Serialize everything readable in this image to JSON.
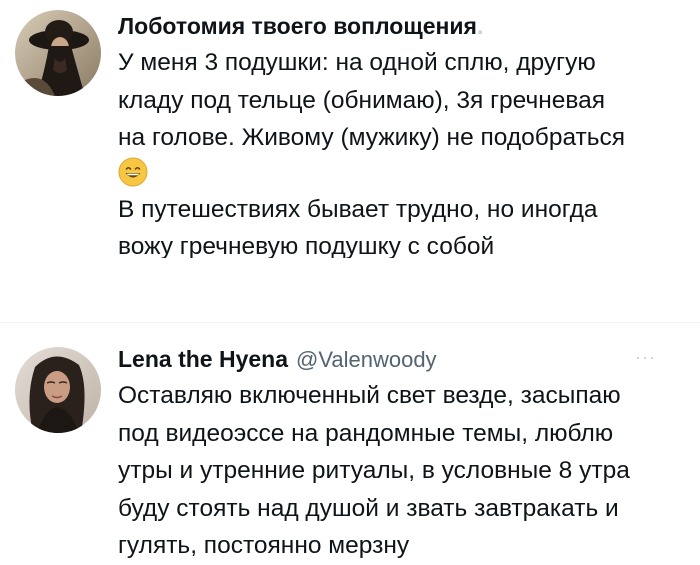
{
  "tweets": [
    {
      "author_name": "Лоботомия твоего воплощения",
      "author_name_faded": ".",
      "lines": [
        "У меня 3 подушки: на одной сплю, другую",
        "кладу под тельце (обнимаю), 3я гречневая",
        "на голове. Живому (мужику) не подобраться"
      ],
      "emoji": "grinning-face-with-smiling-eyes",
      "lines_after_emoji": [
        "В путешествиях бывает трудно, но иногда",
        "вожу гречневую подушку с собой"
      ]
    },
    {
      "author_name": "Lena the Hyena",
      "handle": "@Valenwoody",
      "handle_faded": "",
      "more_label": "···",
      "lines": [
        "Оставляю включенный свет везде, засыпаю",
        "под видеоэссе на рандомные темы, люблю",
        "утры и утренние ритуалы, в условные 8 утра",
        "буду стоять над душой и звать завтракать и",
        "гулять, постоянно мерзну"
      ]
    }
  ],
  "colors": {
    "text": "#0f1419",
    "secondary": "#536471",
    "divider": "#eff3f4",
    "emoji_face": "#f7c744"
  }
}
